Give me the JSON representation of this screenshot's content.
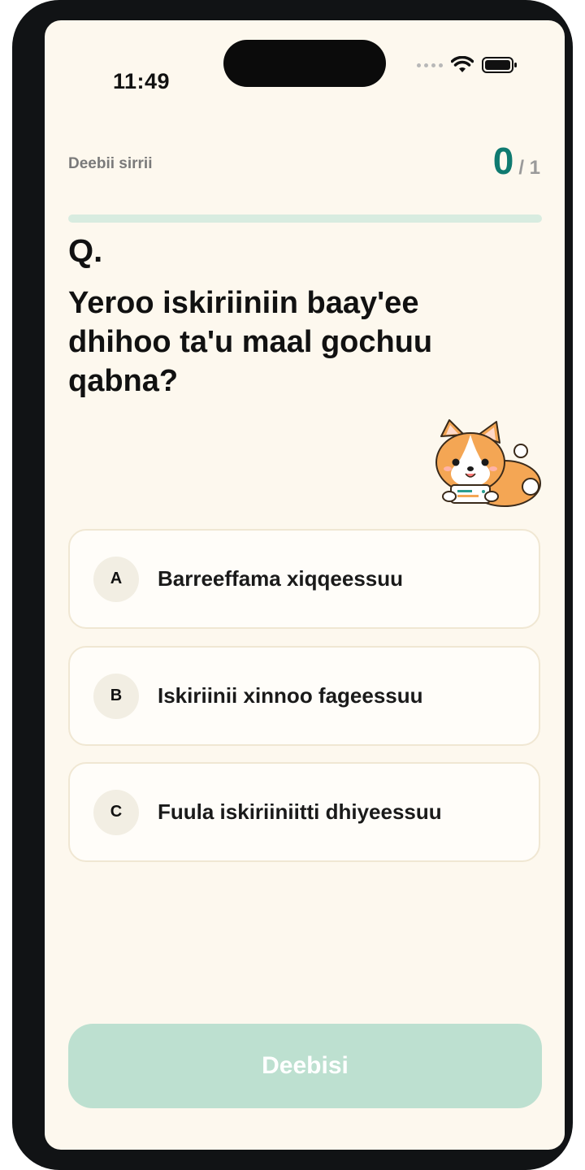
{
  "status_bar": {
    "time": "11:49"
  },
  "header": {
    "progress_label": "Deebii sirrii",
    "score_current": "0",
    "score_total": "/ 1",
    "progress_fraction": 0
  },
  "question": {
    "marker": "Q.",
    "text": "Yeroo iskiriiniin baay'ee dhihoo ta'u maal gochuu qabna?"
  },
  "options": [
    {
      "letter": "A",
      "text": "Barreeffama xiqqeessuu"
    },
    {
      "letter": "B",
      "text": "Iskiriinii xinnoo fageessuu"
    },
    {
      "letter": "C",
      "text": "Fuula iskiriiniitti dhiyeessuu"
    }
  ],
  "footer": {
    "submit_label": "Deebisi"
  },
  "colors": {
    "accent": "#0f7a70",
    "submit_disabled": "#bde0d0",
    "background": "#fdf8ee"
  },
  "icons": [
    "wifi-icon",
    "battery-icon",
    "cellular-signal-icon",
    "corgi-mascot"
  ]
}
